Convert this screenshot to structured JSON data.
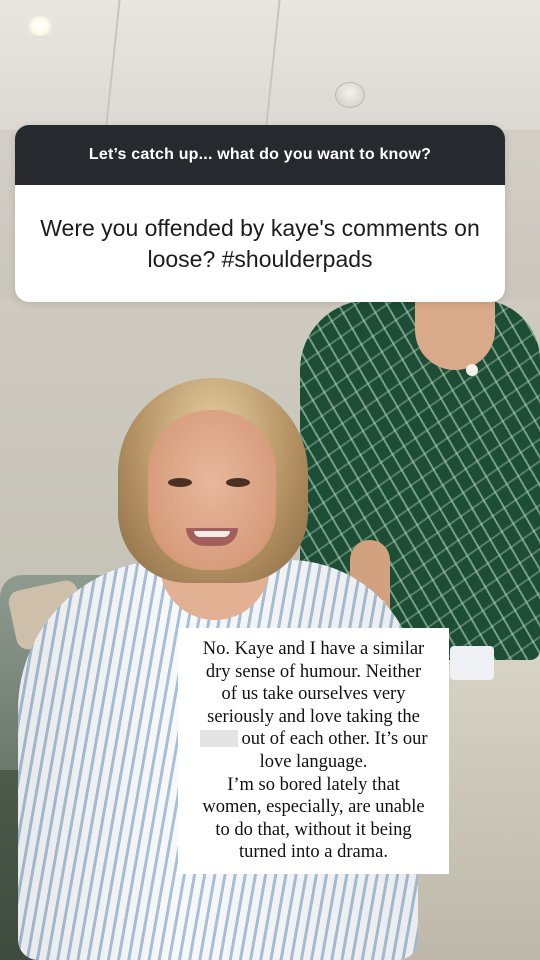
{
  "story": {
    "question_sticker": {
      "prompt": "Let’s catch up... what do you want to know?",
      "question": "Were you offended by kaye's comments on loose? #shoulderpads"
    },
    "answer": {
      "line1": "No. Kaye and I have a similar",
      "line2": "dry sense of humour. Neither",
      "line3": "of us take ourselves very",
      "line4": "seriously and love taking the",
      "line5": "out of each other. It’s our",
      "line6": "love language.",
      "line7": "I’m so bored lately that",
      "line8": "women, especially, are unable",
      "line9": "to do that, without it being",
      "line10": "turned into a drama."
    }
  }
}
